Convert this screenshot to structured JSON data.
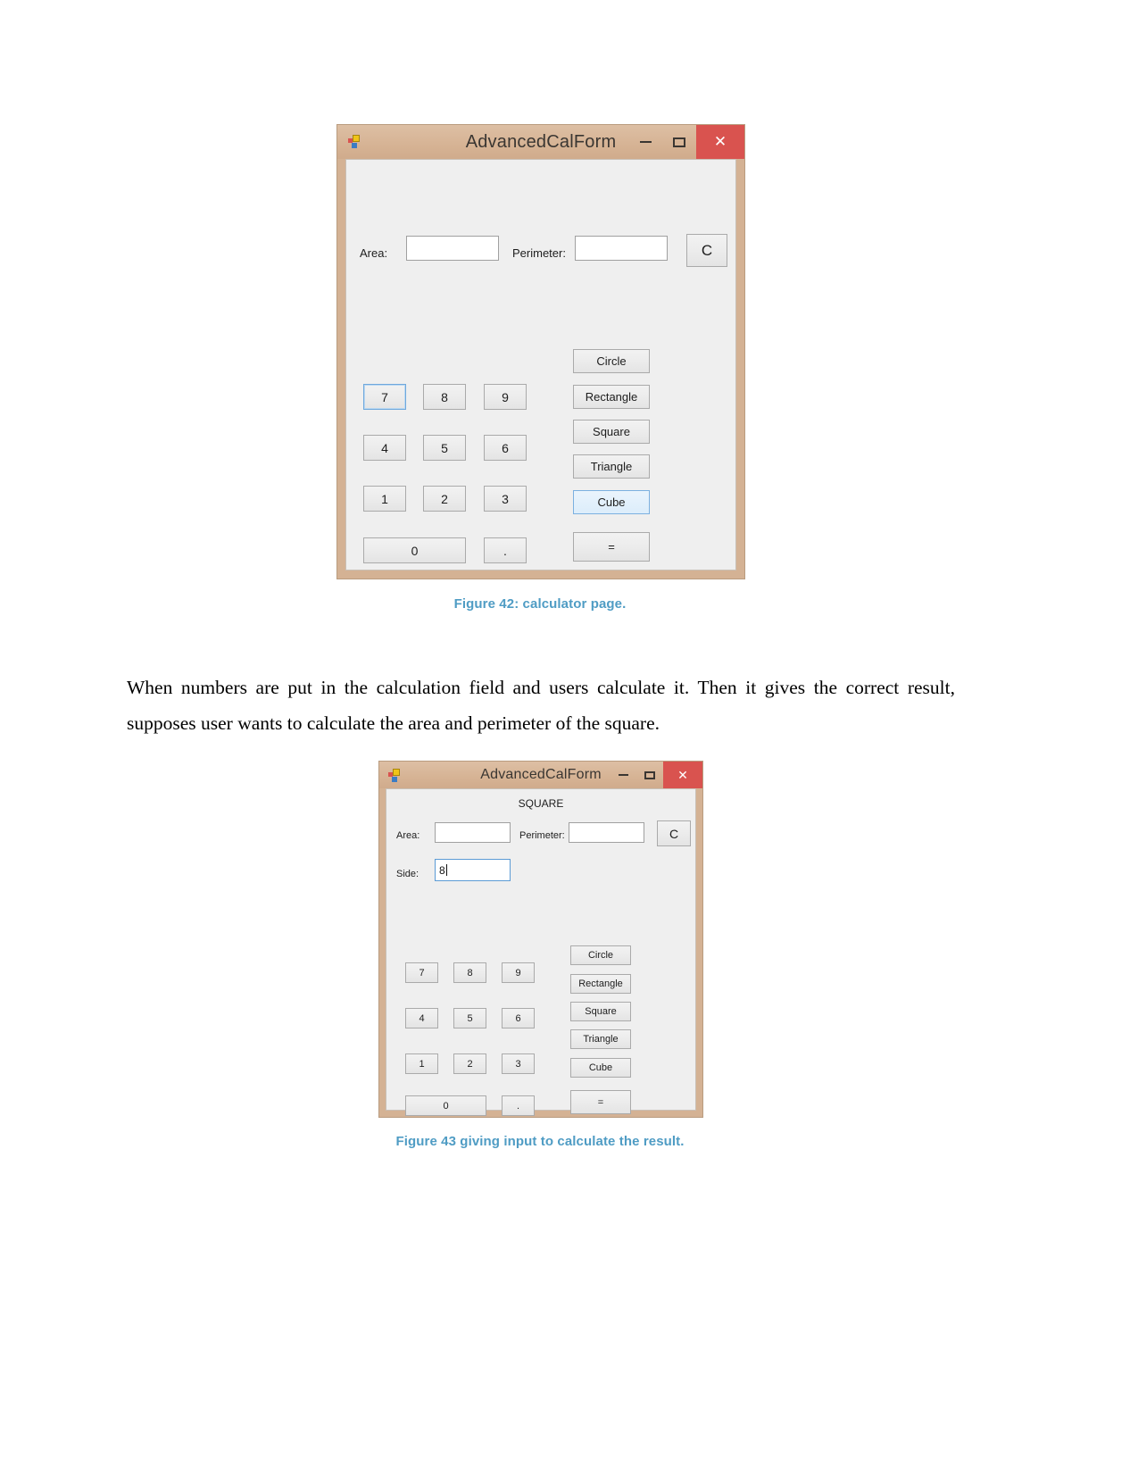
{
  "page": {
    "body_paragraph": "When numbers are put in the calculation field and users calculate it. Then it gives the correct result, supposes user wants to calculate the area and perimeter of the square."
  },
  "figure1": {
    "caption": "Figure 42: calculator page.",
    "window": {
      "title": "AdvancedCalForm",
      "icon": "app-form-icon",
      "controls": {
        "minimize": "minimize-icon",
        "maximize": "maximize-icon",
        "close": "✕"
      }
    },
    "fields": {
      "area_label": "Area:",
      "area_value": "",
      "perimeter_label": "Perimeter:",
      "perimeter_value": "",
      "clear_label": "C"
    },
    "keypad": [
      {
        "label": "7",
        "state": "focused"
      },
      {
        "label": "8",
        "state": "normal"
      },
      {
        "label": "9",
        "state": "normal"
      },
      {
        "label": "4",
        "state": "normal"
      },
      {
        "label": "5",
        "state": "normal"
      },
      {
        "label": "6",
        "state": "normal"
      },
      {
        "label": "1",
        "state": "normal"
      },
      {
        "label": "2",
        "state": "normal"
      },
      {
        "label": "3",
        "state": "normal"
      },
      {
        "label": "0",
        "state": "normal"
      },
      {
        "label": ".",
        "state": "normal"
      }
    ],
    "shapes": [
      {
        "label": "Circle",
        "state": "normal"
      },
      {
        "label": "Rectangle",
        "state": "normal"
      },
      {
        "label": "Square",
        "state": "normal"
      },
      {
        "label": "Triangle",
        "state": "normal"
      },
      {
        "label": "Cube",
        "state": "highlighted"
      }
    ],
    "equals_label": "="
  },
  "figure2": {
    "caption": "Figure 43 giving input to calculate the result.",
    "window": {
      "title": "AdvancedCalForm",
      "icon": "app-form-icon",
      "controls": {
        "minimize": "minimize-icon",
        "maximize": "maximize-icon",
        "close": "✕"
      }
    },
    "shape_heading": "SQUARE",
    "fields": {
      "area_label": "Area:",
      "area_value": "",
      "perimeter_label": "Perimeter:",
      "perimeter_value": "",
      "clear_label": "C",
      "side_label": "Side:",
      "side_value": "8"
    },
    "keypad": [
      {
        "label": "7",
        "state": "normal"
      },
      {
        "label": "8",
        "state": "normal"
      },
      {
        "label": "9",
        "state": "normal"
      },
      {
        "label": "4",
        "state": "normal"
      },
      {
        "label": "5",
        "state": "normal"
      },
      {
        "label": "6",
        "state": "normal"
      },
      {
        "label": "1",
        "state": "normal"
      },
      {
        "label": "2",
        "state": "normal"
      },
      {
        "label": "3",
        "state": "normal"
      },
      {
        "label": "0",
        "state": "normal"
      },
      {
        "label": ".",
        "state": "normal"
      }
    ],
    "shapes": [
      {
        "label": "Circle",
        "state": "normal"
      },
      {
        "label": "Rectangle",
        "state": "normal"
      },
      {
        "label": "Square",
        "state": "normal"
      },
      {
        "label": "Triangle",
        "state": "normal"
      },
      {
        "label": "Cube",
        "state": "normal"
      }
    ],
    "equals_label": "="
  },
  "colors": {
    "window_frame": "#d4b294",
    "client_bg": "#efefef",
    "close_button": "#d9534f",
    "caption_text": "#4f9cc4",
    "focus_blue": "#7bb0e0"
  }
}
